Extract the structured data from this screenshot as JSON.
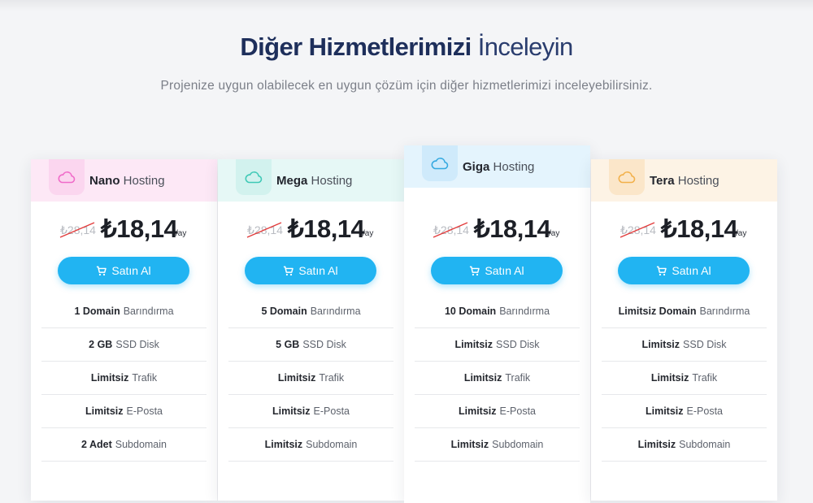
{
  "section": {
    "title_bold": "Diğer Hizmetlerimizi",
    "title_light": "İnceleyin",
    "subtitle": "Projenize uygun olabilecek en uygun çözüm için diğer hizmetlerimizi inceleyebilirsiniz."
  },
  "colors": {
    "accent": "#21b4f2",
    "title": "#1e2f5b"
  },
  "plans": [
    {
      "name": "Nano",
      "suffix": "Hosting",
      "icon": "cloud-icon",
      "head_color": "#fde8f6",
      "tab_color": "#fbd6ef",
      "icon_color": "#f06bc9",
      "old_price": "₺28,14",
      "price": "₺18,14",
      "per": "/ay",
      "buy_label": "Satın Al",
      "features": [
        {
          "key": "1 Domain",
          "label": "Barındırma"
        },
        {
          "key": "2 GB",
          "label": "SSD Disk"
        },
        {
          "key": "Limitsiz",
          "label": "Trafik"
        },
        {
          "key": "Limitsiz",
          "label": "E-Posta"
        },
        {
          "key": "2 Adet",
          "label": "Subdomain"
        }
      ]
    },
    {
      "name": "Mega",
      "suffix": "Hosting",
      "icon": "cloud-icon",
      "head_color": "#e6f8f6",
      "tab_color": "#d2f2ee",
      "icon_color": "#3fc9b6",
      "old_price": "₺28,14",
      "price": "₺18,14",
      "per": "/ay",
      "buy_label": "Satın Al",
      "features": [
        {
          "key": "5 Domain",
          "label": "Barındırma"
        },
        {
          "key": "5 GB",
          "label": "SSD Disk"
        },
        {
          "key": "Limitsiz",
          "label": "Trafik"
        },
        {
          "key": "Limitsiz",
          "label": "E-Posta"
        },
        {
          "key": "Limitsiz",
          "label": "Subdomain"
        }
      ]
    },
    {
      "name": "Giga",
      "suffix": "Hosting",
      "icon": "cloud-icon",
      "head_color": "#e4f4fd",
      "tab_color": "#cfeafb",
      "icon_color": "#35a9e0",
      "old_price": "₺28,14",
      "price": "₺18,14",
      "per": "/ay",
      "buy_label": "Satın Al",
      "features": [
        {
          "key": "10 Domain",
          "label": "Barındırma"
        },
        {
          "key": "Limitsiz",
          "label": "SSD Disk"
        },
        {
          "key": "Limitsiz",
          "label": "Trafik"
        },
        {
          "key": "Limitsiz",
          "label": "E-Posta"
        },
        {
          "key": "Limitsiz",
          "label": "Subdomain"
        }
      ]
    },
    {
      "name": "Tera",
      "suffix": "Hosting",
      "icon": "cloud-icon",
      "head_color": "#fdf3e5",
      "tab_color": "#fbe6c9",
      "icon_color": "#f2b04a",
      "old_price": "₺28,14",
      "price": "₺18,14",
      "per": "/ay",
      "buy_label": "Satın Al",
      "features": [
        {
          "key": "Limitsiz Domain",
          "label": "Barındırma"
        },
        {
          "key": "Limitsiz",
          "label": "SSD Disk"
        },
        {
          "key": "Limitsiz",
          "label": "Trafik"
        },
        {
          "key": "Limitsiz",
          "label": "E-Posta"
        },
        {
          "key": "Limitsiz",
          "label": "Subdomain"
        }
      ]
    }
  ]
}
